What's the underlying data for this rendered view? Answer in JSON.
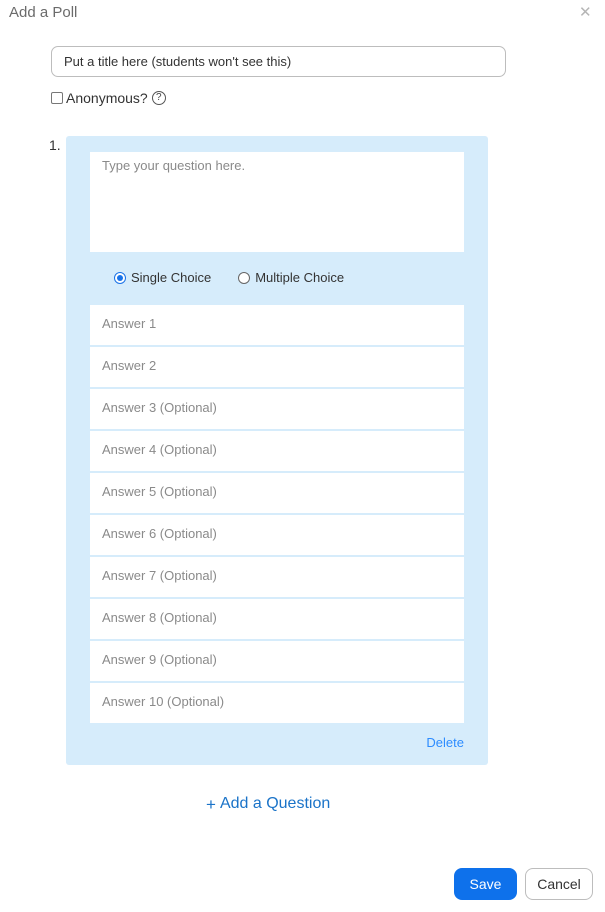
{
  "dialog": {
    "title": "Add a Poll",
    "close_icon": "close-icon"
  },
  "poll_title": {
    "placeholder": "Put a title here (students won't see this)",
    "value": ""
  },
  "anonymous": {
    "label": "Anonymous?",
    "checked": false,
    "help_icon": "?"
  },
  "question": {
    "number": "1.",
    "placeholder": "Type your question here.",
    "type_options": [
      {
        "label": "Single Choice",
        "selected": true
      },
      {
        "label": "Multiple Choice",
        "selected": false
      }
    ],
    "answers": [
      "Answer 1",
      "Answer 2",
      "Answer 3 (Optional)",
      "Answer 4 (Optional)",
      "Answer 5 (Optional)",
      "Answer 6 (Optional)",
      "Answer 7 (Optional)",
      "Answer 8 (Optional)",
      "Answer 9 (Optional)",
      "Answer 10 (Optional)"
    ],
    "delete_label": "Delete"
  },
  "add_question": {
    "icon": "+",
    "label": "Add a Question"
  },
  "footer": {
    "save_label": "Save",
    "cancel_label": "Cancel"
  },
  "colors": {
    "accent": "#0e71eb",
    "question_bg": "#d6ecfb",
    "link": "#2d8cff"
  }
}
